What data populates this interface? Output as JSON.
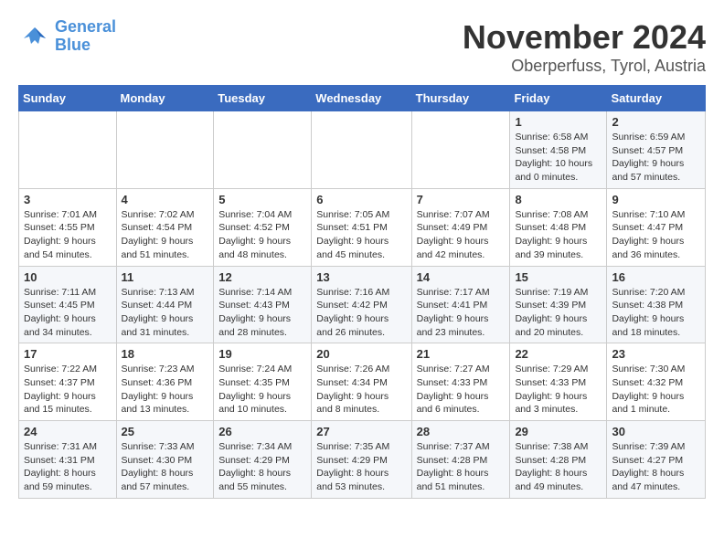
{
  "header": {
    "logo_line1": "General",
    "logo_line2": "Blue",
    "month": "November 2024",
    "location": "Oberperfuss, Tyrol, Austria"
  },
  "weekdays": [
    "Sunday",
    "Monday",
    "Tuesday",
    "Wednesday",
    "Thursday",
    "Friday",
    "Saturday"
  ],
  "weeks": [
    [
      {
        "day": "",
        "info": ""
      },
      {
        "day": "",
        "info": ""
      },
      {
        "day": "",
        "info": ""
      },
      {
        "day": "",
        "info": ""
      },
      {
        "day": "",
        "info": ""
      },
      {
        "day": "1",
        "info": "Sunrise: 6:58 AM\nSunset: 4:58 PM\nDaylight: 10 hours\nand 0 minutes."
      },
      {
        "day": "2",
        "info": "Sunrise: 6:59 AM\nSunset: 4:57 PM\nDaylight: 9 hours\nand 57 minutes."
      }
    ],
    [
      {
        "day": "3",
        "info": "Sunrise: 7:01 AM\nSunset: 4:55 PM\nDaylight: 9 hours\nand 54 minutes."
      },
      {
        "day": "4",
        "info": "Sunrise: 7:02 AM\nSunset: 4:54 PM\nDaylight: 9 hours\nand 51 minutes."
      },
      {
        "day": "5",
        "info": "Sunrise: 7:04 AM\nSunset: 4:52 PM\nDaylight: 9 hours\nand 48 minutes."
      },
      {
        "day": "6",
        "info": "Sunrise: 7:05 AM\nSunset: 4:51 PM\nDaylight: 9 hours\nand 45 minutes."
      },
      {
        "day": "7",
        "info": "Sunrise: 7:07 AM\nSunset: 4:49 PM\nDaylight: 9 hours\nand 42 minutes."
      },
      {
        "day": "8",
        "info": "Sunrise: 7:08 AM\nSunset: 4:48 PM\nDaylight: 9 hours\nand 39 minutes."
      },
      {
        "day": "9",
        "info": "Sunrise: 7:10 AM\nSunset: 4:47 PM\nDaylight: 9 hours\nand 36 minutes."
      }
    ],
    [
      {
        "day": "10",
        "info": "Sunrise: 7:11 AM\nSunset: 4:45 PM\nDaylight: 9 hours\nand 34 minutes."
      },
      {
        "day": "11",
        "info": "Sunrise: 7:13 AM\nSunset: 4:44 PM\nDaylight: 9 hours\nand 31 minutes."
      },
      {
        "day": "12",
        "info": "Sunrise: 7:14 AM\nSunset: 4:43 PM\nDaylight: 9 hours\nand 28 minutes."
      },
      {
        "day": "13",
        "info": "Sunrise: 7:16 AM\nSunset: 4:42 PM\nDaylight: 9 hours\nand 26 minutes."
      },
      {
        "day": "14",
        "info": "Sunrise: 7:17 AM\nSunset: 4:41 PM\nDaylight: 9 hours\nand 23 minutes."
      },
      {
        "day": "15",
        "info": "Sunrise: 7:19 AM\nSunset: 4:39 PM\nDaylight: 9 hours\nand 20 minutes."
      },
      {
        "day": "16",
        "info": "Sunrise: 7:20 AM\nSunset: 4:38 PM\nDaylight: 9 hours\nand 18 minutes."
      }
    ],
    [
      {
        "day": "17",
        "info": "Sunrise: 7:22 AM\nSunset: 4:37 PM\nDaylight: 9 hours\nand 15 minutes."
      },
      {
        "day": "18",
        "info": "Sunrise: 7:23 AM\nSunset: 4:36 PM\nDaylight: 9 hours\nand 13 minutes."
      },
      {
        "day": "19",
        "info": "Sunrise: 7:24 AM\nSunset: 4:35 PM\nDaylight: 9 hours\nand 10 minutes."
      },
      {
        "day": "20",
        "info": "Sunrise: 7:26 AM\nSunset: 4:34 PM\nDaylight: 9 hours\nand 8 minutes."
      },
      {
        "day": "21",
        "info": "Sunrise: 7:27 AM\nSunset: 4:33 PM\nDaylight: 9 hours\nand 6 minutes."
      },
      {
        "day": "22",
        "info": "Sunrise: 7:29 AM\nSunset: 4:33 PM\nDaylight: 9 hours\nand 3 minutes."
      },
      {
        "day": "23",
        "info": "Sunrise: 7:30 AM\nSunset: 4:32 PM\nDaylight: 9 hours\nand 1 minute."
      }
    ],
    [
      {
        "day": "24",
        "info": "Sunrise: 7:31 AM\nSunset: 4:31 PM\nDaylight: 8 hours\nand 59 minutes."
      },
      {
        "day": "25",
        "info": "Sunrise: 7:33 AM\nSunset: 4:30 PM\nDaylight: 8 hours\nand 57 minutes."
      },
      {
        "day": "26",
        "info": "Sunrise: 7:34 AM\nSunset: 4:29 PM\nDaylight: 8 hours\nand 55 minutes."
      },
      {
        "day": "27",
        "info": "Sunrise: 7:35 AM\nSunset: 4:29 PM\nDaylight: 8 hours\nand 53 minutes."
      },
      {
        "day": "28",
        "info": "Sunrise: 7:37 AM\nSunset: 4:28 PM\nDaylight: 8 hours\nand 51 minutes."
      },
      {
        "day": "29",
        "info": "Sunrise: 7:38 AM\nSunset: 4:28 PM\nDaylight: 8 hours\nand 49 minutes."
      },
      {
        "day": "30",
        "info": "Sunrise: 7:39 AM\nSunset: 4:27 PM\nDaylight: 8 hours\nand 47 minutes."
      }
    ]
  ]
}
